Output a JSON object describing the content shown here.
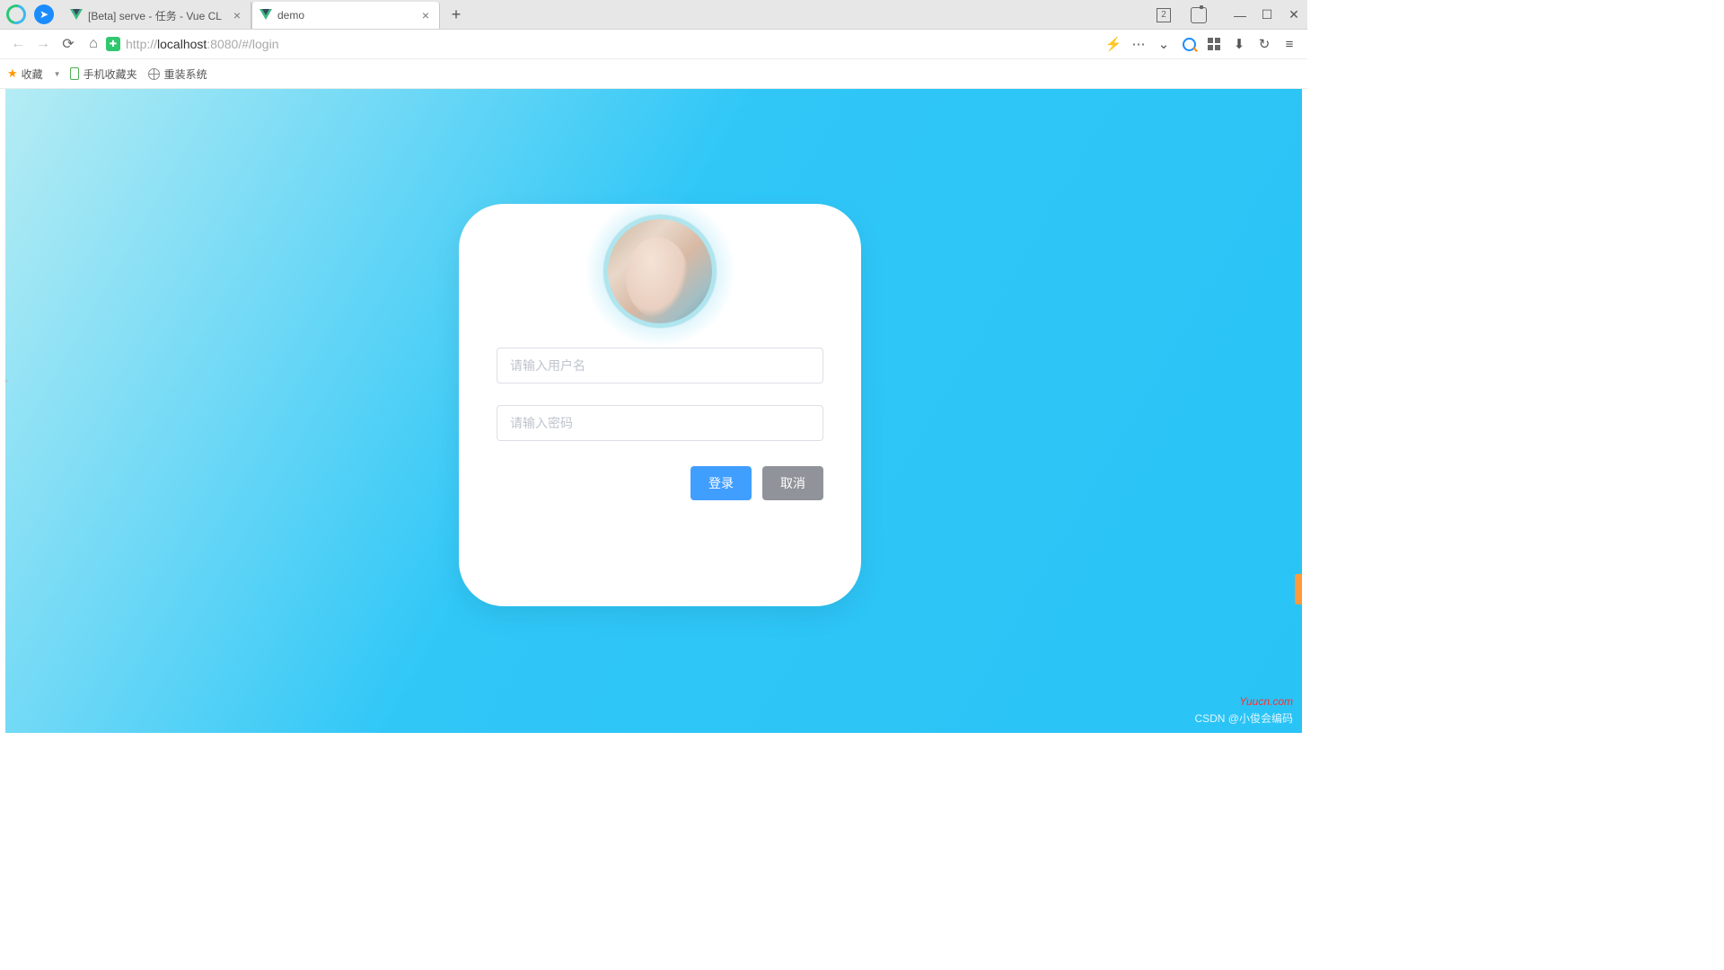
{
  "browser": {
    "tabs": [
      {
        "title": "[Beta] serve - 任务 - Vue CL"
      },
      {
        "title": "demo"
      }
    ],
    "new_tab_badge": "2",
    "window_buttons": {
      "min": "—",
      "max": "☐",
      "close": "✕"
    }
  },
  "addressbar": {
    "protocol": "http://",
    "host": "localhost",
    "rest": ":8080/#/login",
    "tools": {
      "bolt": "⚡",
      "more": "⋯",
      "chev": "⌄",
      "download": "⬇",
      "undo": "↻",
      "menu": "≡"
    }
  },
  "bookmarks": {
    "fav": "收藏",
    "mobile": "手机收藏夹",
    "reinstall": "重装系统"
  },
  "login": {
    "username_placeholder": "请输入用户名",
    "password_placeholder": "请输入密码",
    "login_btn": "登录",
    "cancel_btn": "取消"
  },
  "watermark": {
    "site": "Yuucn.com",
    "csdn": "CSDN @小俊会编码"
  }
}
